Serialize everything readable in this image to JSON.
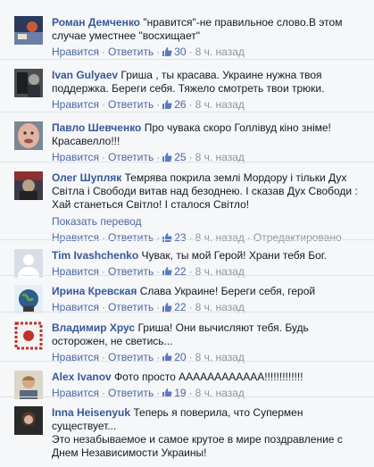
{
  "actions": {
    "like": "Нравится",
    "reply": "Ответить",
    "sep": "·",
    "translate": "Показать перевод",
    "edited": "Отредактировано"
  },
  "colors": {
    "link": "#4b67a1",
    "author": "#365899",
    "meta": "#90949c",
    "background": "#f6f7f9"
  },
  "comments": [
    {
      "author": "Роман Демченко",
      "text": "\"нравится\"-не правильное слово.В этом случае уместнее \"восхищает\"",
      "likes": "30",
      "time": "8 ч. назад",
      "avatar": "avatar-photo"
    },
    {
      "author": "Ivan Gulyaev",
      "text": "Гриша , ты красава. Украине нужна твоя поддержка. Береги себя. Тяжело смотреть твои трюки.",
      "likes": "26",
      "time": "8 ч. назад",
      "avatar": "avatar-photo"
    },
    {
      "author": "Павло Шевченко",
      "text": "Про чувака скоро Голлівуд кіно зніме! Красавелло!!!",
      "likes": "25",
      "time": "8 ч. назад",
      "avatar": "avatar-photo"
    },
    {
      "author": "Олег Шупляк",
      "text": "Темрява покрила землі Мордору і тільки Дух Світла і Свободи витав над безоднею. І сказав Дух Свободи : Хай станеться Світло! І сталося Світло!",
      "likes": "23",
      "time": "8 ч. назад",
      "avatar": "avatar-photo"
    },
    {
      "author": "Tim Ivashchenko",
      "text": "Чувак, ты мой Герой! Храни тебя Бог.",
      "likes": "22",
      "time": "8 ч. назад",
      "avatar": "default-avatar"
    },
    {
      "author": "Ирина Кревская",
      "text": "Слава Украине! Береги себя, герой",
      "likes": "22",
      "time": "8 ч. назад",
      "avatar": "avatar-photo"
    },
    {
      "author": "Владимир Хрус",
      "text": "Гриша! Они вычисляют тебя. Будь осторожен, не светись...",
      "likes": "20",
      "time": "8 ч. назад",
      "avatar": "avatar-photo"
    },
    {
      "author": "Alex Ivanov",
      "text": "Фото просто АААААААААААА!!!!!!!!!!!!!",
      "likes": "19",
      "time": "8 ч. назад",
      "avatar": "avatar-photo"
    },
    {
      "author": "Inna Heisenyuk",
      "text": "Теперь я поверила, что Супермен существует...",
      "text2": "Это незабываемое и самое крутое в мире поздравление с Днем Независимости Украины!",
      "avatar": "avatar-photo"
    }
  ]
}
